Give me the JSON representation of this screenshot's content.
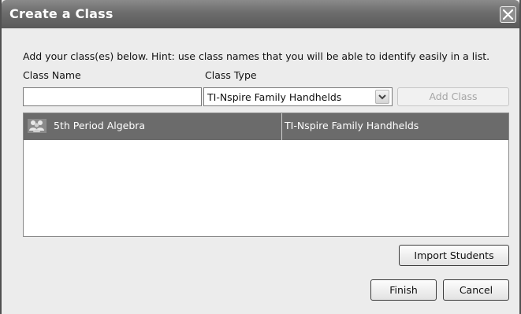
{
  "dialog": {
    "title": "Create a Class"
  },
  "hint": "Add your class(es) below.  Hint: use class names that you will be able to identify easily in a list.",
  "labels": {
    "class_name": "Class Name",
    "class_type": "Class Type"
  },
  "class_name_input": {
    "value": "",
    "placeholder": ""
  },
  "class_type_select": {
    "selected": "TI-Nspire Family Handhelds"
  },
  "buttons": {
    "add_class": "Add Class",
    "import_students": "Import Students",
    "finish": "Finish",
    "cancel": "Cancel"
  },
  "class_list": {
    "rows": [
      {
        "icon": "group-icon",
        "name": "5th Period Algebra",
        "type": "TI-Nspire Family Handhelds",
        "selected": true
      }
    ]
  },
  "colors": {
    "titlebar": "#6c6c6c",
    "selected_row": "#6b6b6b",
    "dialog_bg": "#ececec"
  }
}
